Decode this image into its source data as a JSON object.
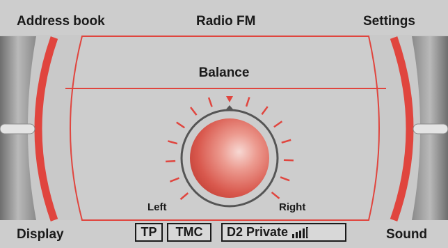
{
  "softkeys": {
    "top_left": "Address book",
    "top_center": "Radio FM",
    "top_right": "Settings",
    "bottom_left": "Display",
    "bottom_right": "Sound"
  },
  "status": {
    "tp": "TP",
    "tmc": "TMC",
    "station": "D2 Private",
    "signal_bars_filled": 4,
    "signal_bars_total": 5
  },
  "balance": {
    "title": "Balance",
    "left_label": "Left",
    "right_label": "Right",
    "value": 0
  },
  "colors": {
    "accent_red": "#e0453e",
    "background": "#c9c9c9",
    "knob": "#e87a6e"
  }
}
